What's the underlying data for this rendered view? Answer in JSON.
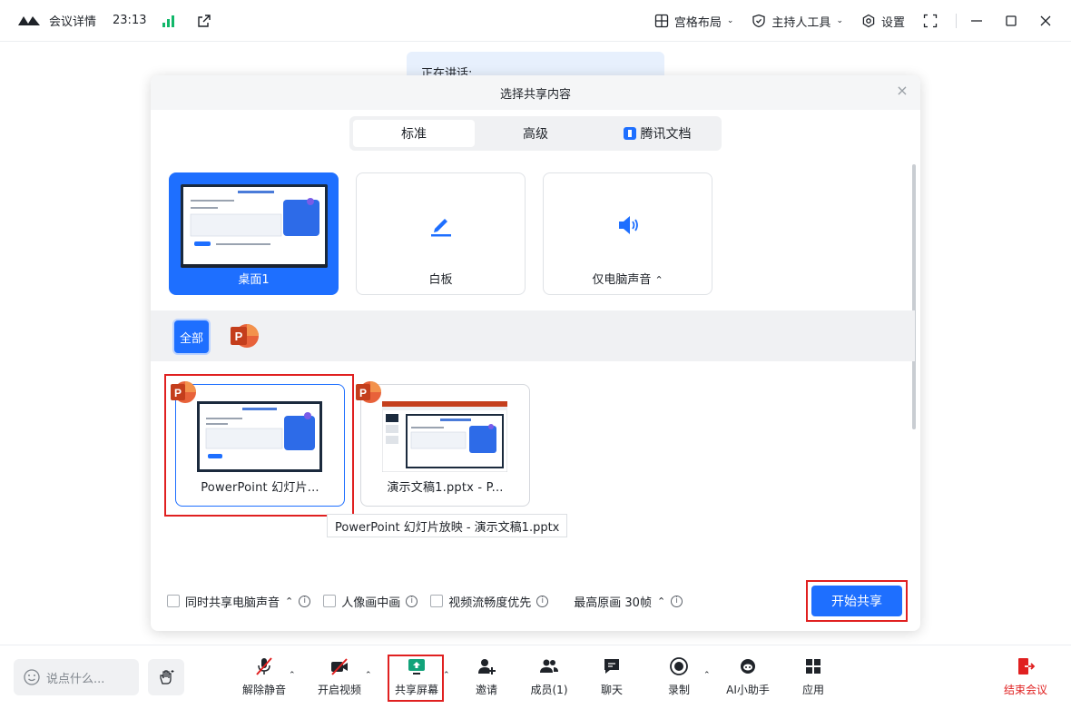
{
  "titlebar": {
    "title": "会议详情",
    "time": "23:13",
    "layout_label": "宫格布局",
    "host_tools_label": "主持人工具",
    "settings_label": "设置"
  },
  "speaking": {
    "label": "正在讲话:"
  },
  "dialog": {
    "title": "选择共享内容",
    "tabs": [
      {
        "label": "标准",
        "active": true
      },
      {
        "label": "高级",
        "active": false
      },
      {
        "label": "腾讯文档",
        "active": false
      }
    ],
    "top_cards": [
      {
        "label": "桌面1",
        "selected": true
      },
      {
        "label": "白板",
        "selected": false
      },
      {
        "label": "仅电脑声音",
        "selected": false
      }
    ],
    "filter": {
      "all_label": "全部",
      "app_icon": "powerpoint-icon"
    },
    "windows": [
      {
        "label": "PowerPoint 幻灯片...",
        "app_icon": "powerpoint-icon",
        "selected": true
      },
      {
        "label": "演示文稿1.pptx - P...",
        "app_icon": "powerpoint-icon",
        "selected": false
      }
    ],
    "tooltip": "PowerPoint 幻灯片放映  -  演示文稿1.pptx",
    "options": {
      "share_sound": "同时共享电脑声音",
      "pip": "人像画中画",
      "video_smooth": "视频流畅度优先",
      "max_quality": "最高原画 30帧"
    },
    "start_label": "开始共享"
  },
  "bottombar": {
    "say_placeholder": "说点什么...",
    "tools": [
      {
        "label": "解除静音",
        "icon": "mic-off-icon"
      },
      {
        "label": "开启视频",
        "icon": "video-off-icon"
      },
      {
        "label": "共享屏幕",
        "icon": "share-screen-icon"
      },
      {
        "label": "邀请",
        "icon": "invite-icon"
      },
      {
        "label": "成员(1)",
        "icon": "members-icon"
      },
      {
        "label": "聊天",
        "icon": "chat-icon"
      },
      {
        "label": "录制",
        "icon": "record-icon"
      },
      {
        "label": "AI小助手",
        "icon": "ai-assistant-icon"
      },
      {
        "label": "应用",
        "icon": "apps-icon"
      }
    ],
    "end_label": "结束会议"
  },
  "colors": {
    "accent": "#1e6fff",
    "danger": "#e02020",
    "signal": "#12b76a",
    "ppt": "#d24726"
  }
}
